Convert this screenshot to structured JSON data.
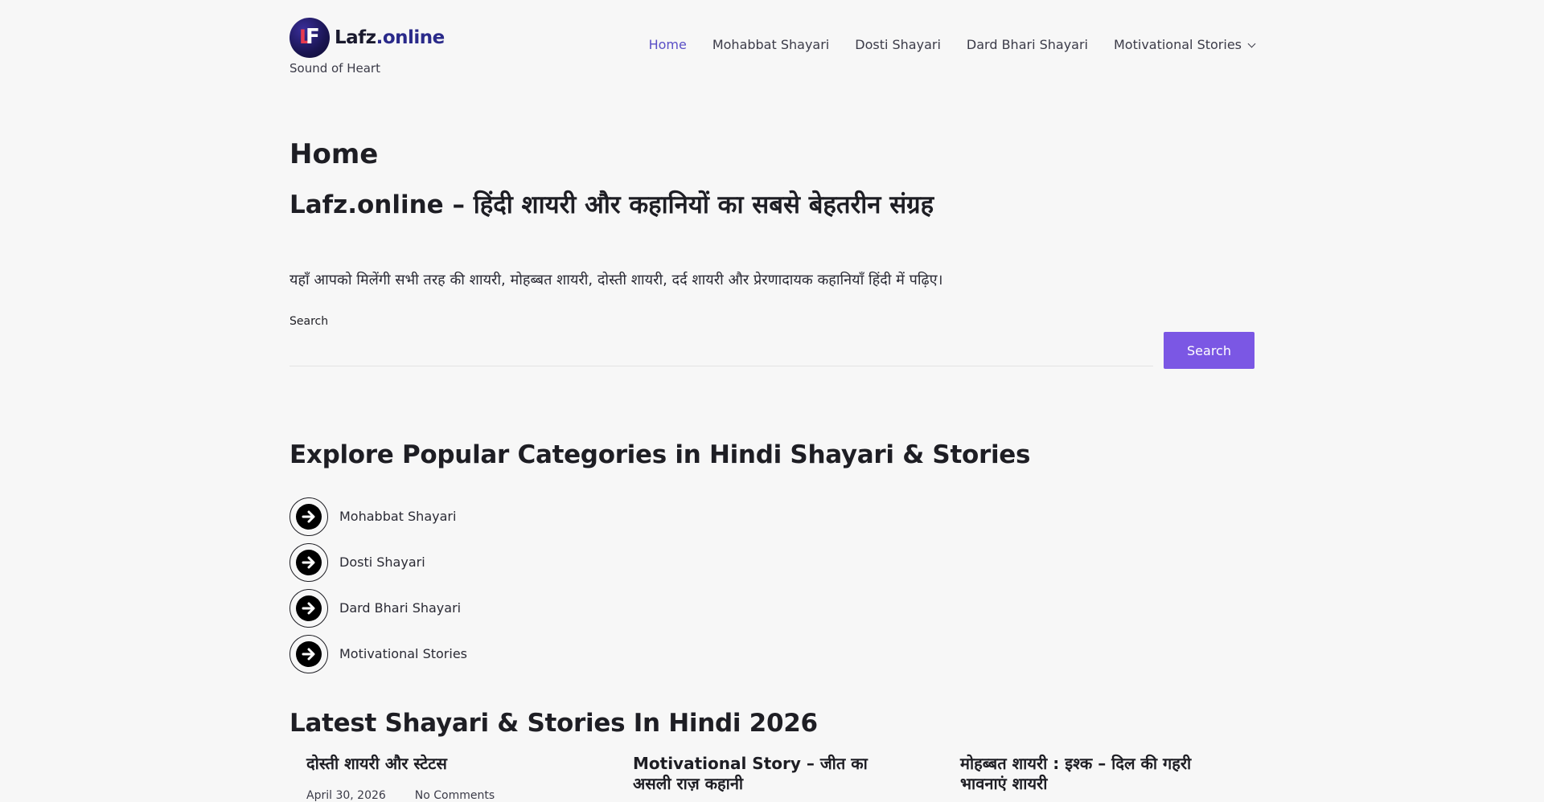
{
  "site": {
    "logo_text_main": "Lafz",
    "logo_text_tld": ".online",
    "tagline": "Sound of Heart"
  },
  "nav": {
    "items": [
      {
        "label": "Home",
        "active": true
      },
      {
        "label": "Mohabbat Shayari"
      },
      {
        "label": "Dosti Shayari"
      },
      {
        "label": "Dard Bhari Shayari"
      },
      {
        "label": "Motivational Stories",
        "has_dropdown": true
      }
    ]
  },
  "main": {
    "page_title": "Home",
    "hero_title": "Lafz.online – हिंदी शायरी और कहानियों का सबसे बेहतरीन संग्रह",
    "hero_subtitle": "यहाँ आपको मिलेंगी सभी तरह की शायरी, मोहब्बत शायरी, दोस्ती शायरी, दर्द शायरी और प्रेरणादायक कहानियाँ हिंदी में पढ़िए।",
    "search": {
      "label": "Search",
      "placeholder": "",
      "value": "",
      "button_label": "Search"
    },
    "categories_title": "Explore Popular Categories in Hindi Shayari & Stories",
    "categories": [
      {
        "label": "Mohabbat Shayari",
        "icon": "arrow-right-circle-icon"
      },
      {
        "label": "Dosti Shayari",
        "icon": "arrow-right-circle-icon"
      },
      {
        "label": "Dard Bhari Shayari",
        "icon": "arrow-right-circle-icon"
      },
      {
        "label": "Motivational Stories",
        "icon": "arrow-right-circle-icon"
      }
    ],
    "latest_title": "Latest Shayari & Stories In Hindi 2026",
    "posts": [
      {
        "title": "दोस्ती शायरी और स्टेटस",
        "date": "April 30, 2026",
        "comments": "No Comments"
      },
      {
        "title": "Motivational Story – जीत का असली राज़ कहानी",
        "date": "",
        "comments": ""
      },
      {
        "title": "मोहब्बत शायरी : इश्क – दिल की गहरी भावनाएं शायरी",
        "date": "",
        "comments": ""
      }
    ]
  },
  "colors": {
    "accent": "#7b57e4",
    "nav_active": "#5a4fc6",
    "background": "#f7f7f7"
  }
}
